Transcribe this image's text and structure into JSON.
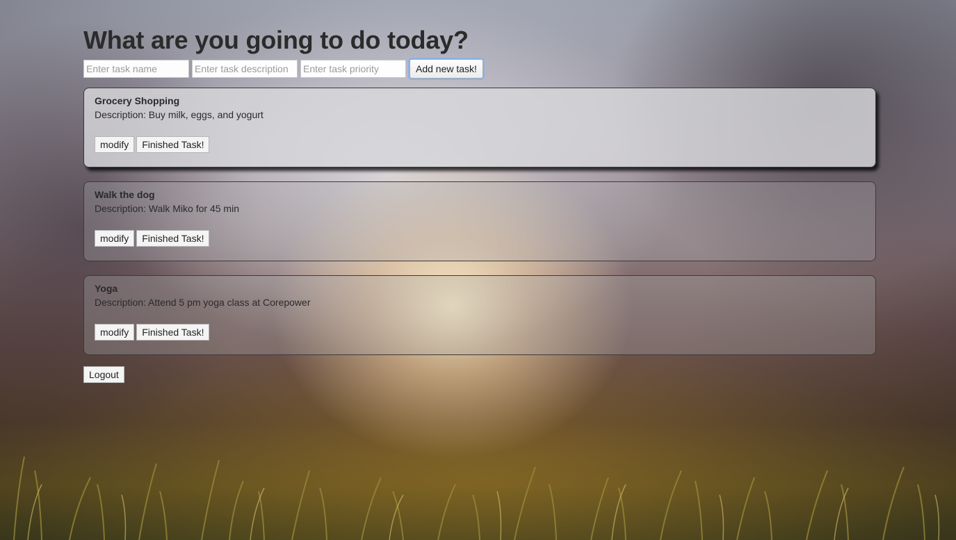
{
  "page": {
    "heading": "What are you going to do today?"
  },
  "add_form": {
    "name_placeholder": "Enter task name",
    "description_placeholder": "Enter task description",
    "priority_placeholder": "Enter task priority",
    "add_button_label": "Add new task!"
  },
  "tasks": [
    {
      "name": "Grocery Shopping",
      "description": "Description: Buy milk, eggs, and yogurt",
      "modify_label": "modify",
      "finish_label": "Finished Task!"
    },
    {
      "name": "Walk the dog",
      "description": "Description: Walk Miko for 45 min",
      "modify_label": "modify",
      "finish_label": "Finished Task!"
    },
    {
      "name": "Yoga",
      "description": "Description: Attend 5 pm yoga class at Corepower",
      "modify_label": "modify",
      "finish_label": "Finished Task!"
    }
  ],
  "logout_label": "Logout"
}
